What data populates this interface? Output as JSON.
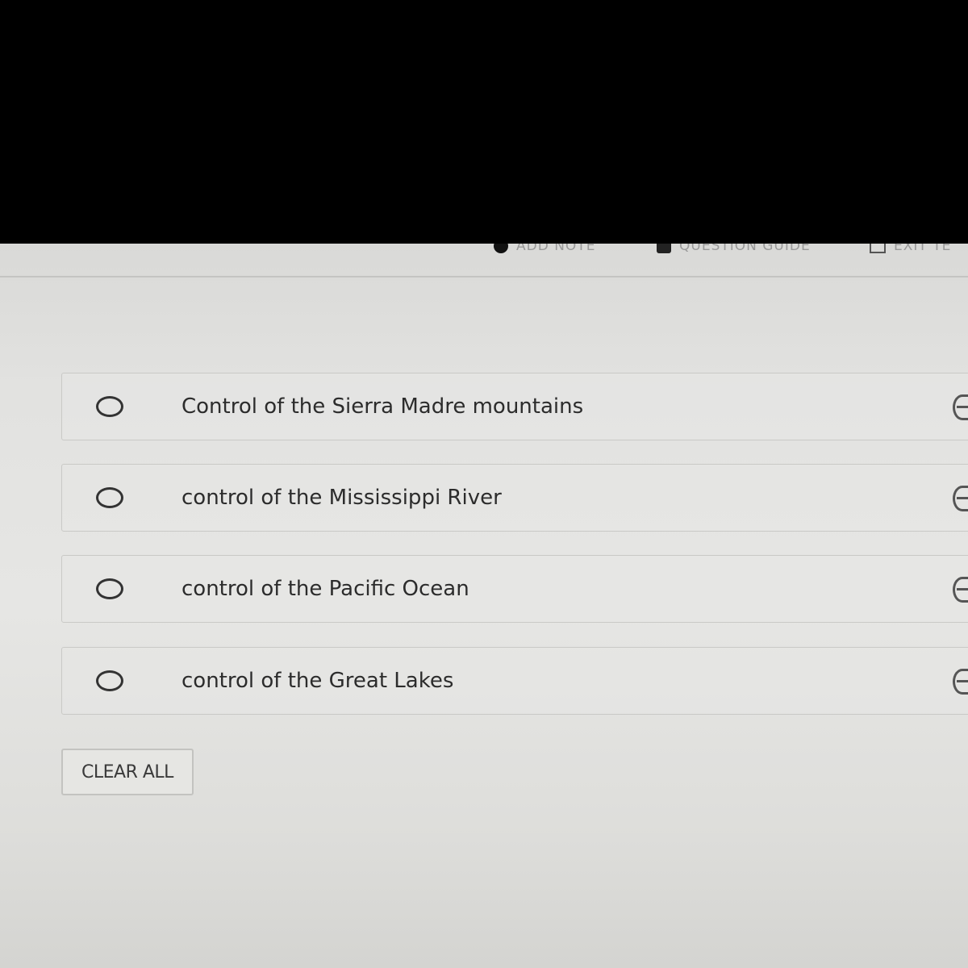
{
  "toolbar": {
    "add_note_label": "ADD NOTE",
    "question_guide_label": "QUESTION GUIDE",
    "exit_label": "EXIT TE"
  },
  "options": [
    {
      "label": "Control of the Sierra Madre mountains"
    },
    {
      "label": "control of the Mississippi River"
    },
    {
      "label": "control of the Pacific Ocean"
    },
    {
      "label": "control of the Great Lakes"
    }
  ],
  "clear_all_label": "CLEAR ALL"
}
